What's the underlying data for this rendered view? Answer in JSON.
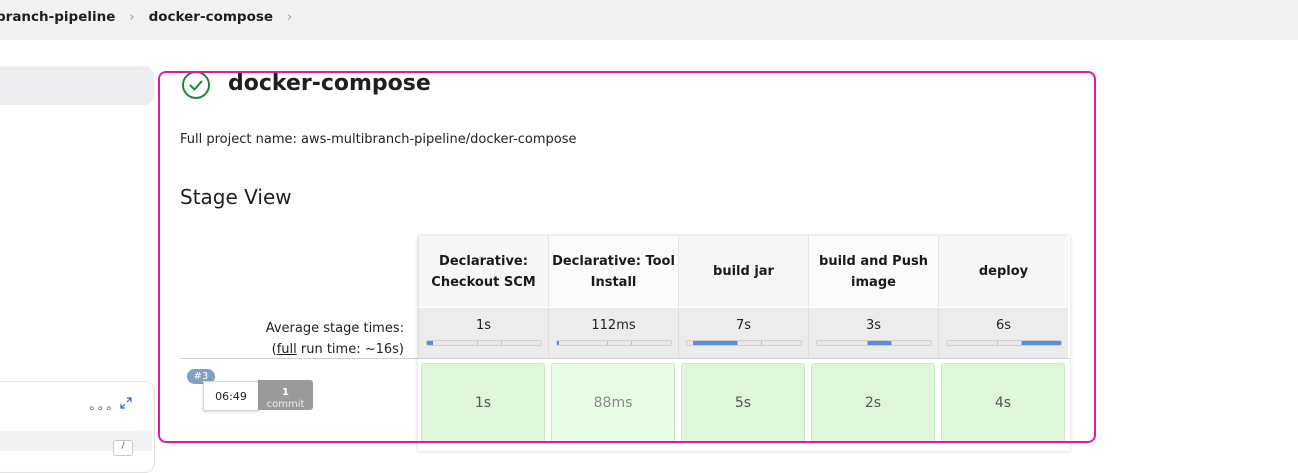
{
  "breadcrumb": {
    "items": [
      "branch-pipeline",
      "docker-compose"
    ]
  },
  "job": {
    "title": "docker-compose",
    "full_project_name_label": "Full project name:",
    "full_project_name": "aws-multibranch-pipeline/docker-compose",
    "status": "success"
  },
  "stage_view": {
    "heading": "Stage View",
    "average_label": "Average stage times:",
    "full_run_open": "(",
    "full_run_link": "full",
    "full_run_rest": " run time: ~16s)",
    "stages": [
      {
        "name": "Declarative: Checkout SCM",
        "avg": "1s",
        "avg_fill_start": 0.0,
        "avg_fill_end": 0.05
      },
      {
        "name": "Declarative: Tool Install",
        "avg": "112ms",
        "avg_fill_start": 0.0,
        "avg_fill_end": 0.01
      },
      {
        "name": "build jar",
        "avg": "7s",
        "avg_fill_start": 0.05,
        "avg_fill_end": 0.45
      },
      {
        "name": "build and Push image",
        "avg": "3s",
        "avg_fill_start": 0.45,
        "avg_fill_end": 0.66
      },
      {
        "name": "deploy",
        "avg": "6s",
        "avg_fill_start": 0.66,
        "avg_fill_end": 1.0
      }
    ],
    "runs": [
      {
        "number": "#3",
        "time": "06:49",
        "commits_count": "1",
        "commits_label": "commit",
        "durations": [
          "1s",
          "88ms",
          "5s",
          "2s",
          "4s"
        ]
      }
    ]
  },
  "sidebar": {
    "more_label": "∘∘∘",
    "chip_label": "/"
  },
  "colors": {
    "highlight": "#e21aa3",
    "success": "#138a36",
    "stage_success_bg": "#dff6db",
    "progress_fill": "#5b8ed6"
  },
  "icons": {
    "status": "check-circle-icon",
    "breadcrumb_separator": "chevron-right-icon",
    "expand": "expand-icon"
  }
}
